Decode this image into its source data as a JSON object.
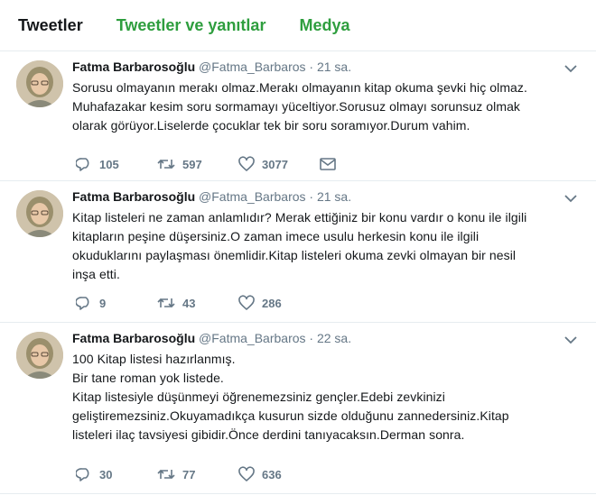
{
  "tabs": [
    {
      "label": "Tweetler"
    },
    {
      "label": "Tweetler ve yanıtlar"
    },
    {
      "label": "Medya"
    }
  ],
  "tweets": [
    {
      "name": "Fatma Barbarosoğlu",
      "handle": "@Fatma_Barbaros",
      "dot": "·",
      "time": "21 sa.",
      "lines": [
        "Sorusu olmayanın merakı olmaz.Merakı olmayanın kitap okuma şevki hiç olmaz.",
        "Muhafazakar kesim soru sormamayı yüceltiyor.Sorusuz olmayı sorunsuz olmak",
        "olarak görüyor.Liselerde çocuklar tek bir soru soramıyor.Durum vahim."
      ],
      "replies": "105",
      "retweets": "597",
      "likes": "3077"
    },
    {
      "name": "Fatma Barbarosoğlu",
      "handle": "@Fatma_Barbaros",
      "dot": "·",
      "time": "21 sa.",
      "lines": [
        "Kitap listeleri ne zaman anlamlıdır? Merak ettiğiniz bir konu vardır o konu ile ilgili",
        "kitapların peşine düşersiniz.O zaman imece usulu herkesin konu ile ilgili",
        "okuduklarını paylaşması önemlidir.Kitap listeleri okuma zevki olmayan bir nesil",
        "inşa etti."
      ],
      "replies": "9",
      "retweets": "43",
      "likes": "286"
    },
    {
      "name": "Fatma Barbarosoğlu",
      "handle": "@Fatma_Barbaros",
      "dot": "·",
      "time": "22 sa.",
      "lines": [
        "100 Kitap listesi hazırlanmış.",
        "Bir tane roman yok listede.",
        "Kitap listesiyle düşünmeyi öğrenemezsiniz gençler.Edebi zevkinizi",
        "geliştiremezsiniz.Okuyamadıkça kusurun sizde olduğunu zannedersiniz.Kitap",
        "listeleri ilaç tavsiyesi gibidir.Önce derdini tanıyacaksın.Derman  sonra."
      ],
      "replies": "30",
      "retweets": "77",
      "likes": "636"
    }
  ],
  "icons": {
    "reply": "reply-icon",
    "retweet": "retweet-icon",
    "like": "heart-icon",
    "dm": "envelope-icon",
    "caret": "chevron-down-icon"
  },
  "colors": {
    "active_tab": "#14171a",
    "inactive_tab": "#2e9e3e",
    "muted": "#657786"
  }
}
